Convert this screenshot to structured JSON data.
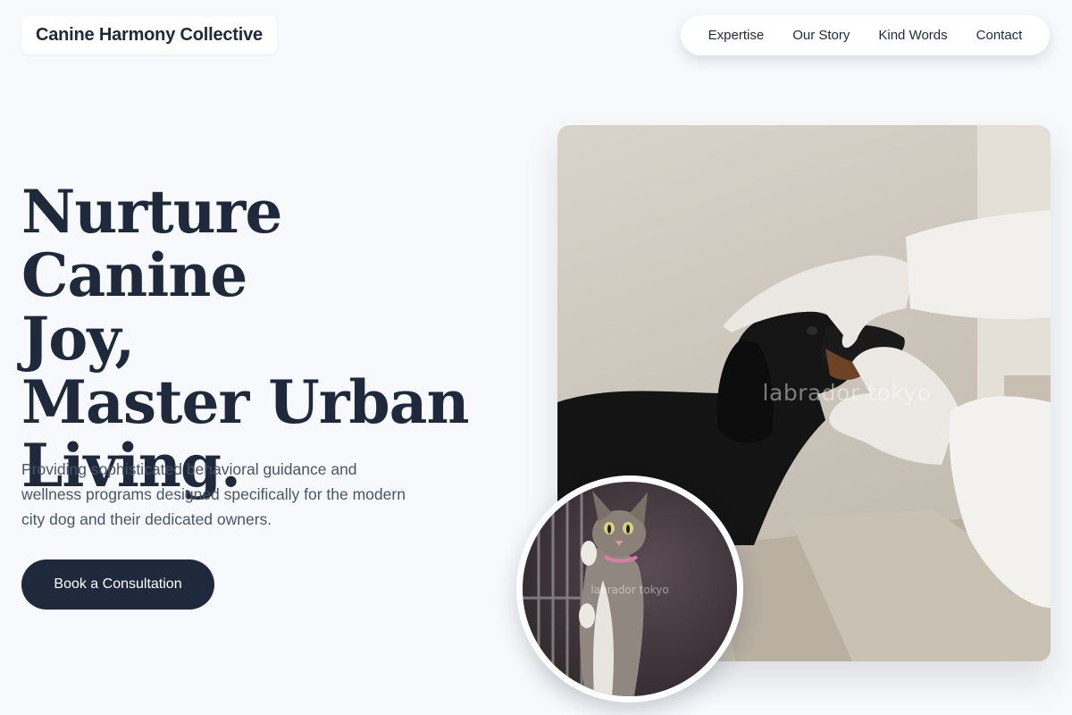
{
  "header": {
    "brand": "Canine Harmony Collective",
    "nav": [
      "Expertise",
      "Our Story",
      "Kind Words",
      "Contact"
    ]
  },
  "hero": {
    "title_lines": [
      "Nurture Canine",
      "Joy,",
      "Master Urban",
      "Living."
    ],
    "description": "Providing sophisticated behavioral guidance and wellness programs designed specifically for the modern city dog and their dedicated owners.",
    "cta_label": "Book a Consultation"
  },
  "images": {
    "main_watermark": "labrador tokyo",
    "circle_watermark": "labrador tokyo"
  },
  "colors": {
    "background": "#f7f9fc",
    "primary": "#1e293b",
    "text_muted": "#475569",
    "surface": "#ffffff"
  }
}
